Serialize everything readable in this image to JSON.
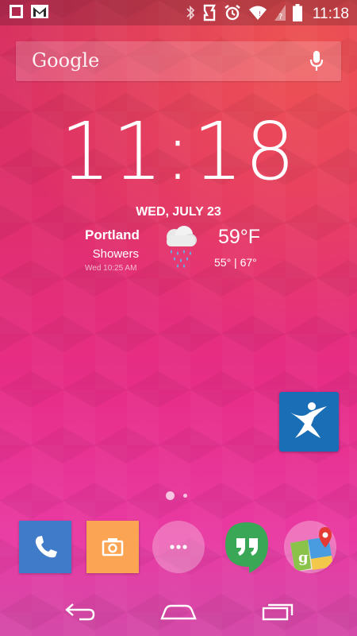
{
  "status_bar": {
    "time": "11:18",
    "left_icons": [
      "square-notification-icon",
      "gmail-icon"
    ],
    "right_icons": [
      "bluetooth-icon",
      "vibrate-icon",
      "alarm-icon",
      "wifi-icon",
      "signal-icon",
      "battery-icon"
    ]
  },
  "search": {
    "logo_text": "Google",
    "mic_icon": "mic-icon"
  },
  "clock": {
    "time": "11:18"
  },
  "weather": {
    "date": "WED, JULY 23",
    "city": "Portland",
    "condition": "Showers",
    "updated": "Wed 10:25 AM",
    "temperature": "59°F",
    "range": "55° | 67°",
    "icon": "rain-cloud-icon"
  },
  "home_apps": [
    {
      "name": "fitness-app",
      "icon": "running-person-icon"
    }
  ],
  "page_indicator": {
    "pages": 2,
    "current": 1
  },
  "dock": [
    {
      "name": "phone",
      "icon": "phone-icon",
      "color": "#3f7bc8"
    },
    {
      "name": "camera",
      "icon": "camera-icon",
      "color": "#fba453"
    },
    {
      "name": "app-drawer",
      "icon": "dots-icon"
    },
    {
      "name": "hangouts",
      "icon": "hangouts-icon",
      "color": "#3aa757"
    },
    {
      "name": "maps",
      "icon": "maps-icon"
    }
  ],
  "nav": [
    "back-icon",
    "home-icon",
    "recents-icon"
  ],
  "colors": {
    "wallpaper_top": "#d8335f",
    "wallpaper_bottom": "#e93aa3"
  }
}
